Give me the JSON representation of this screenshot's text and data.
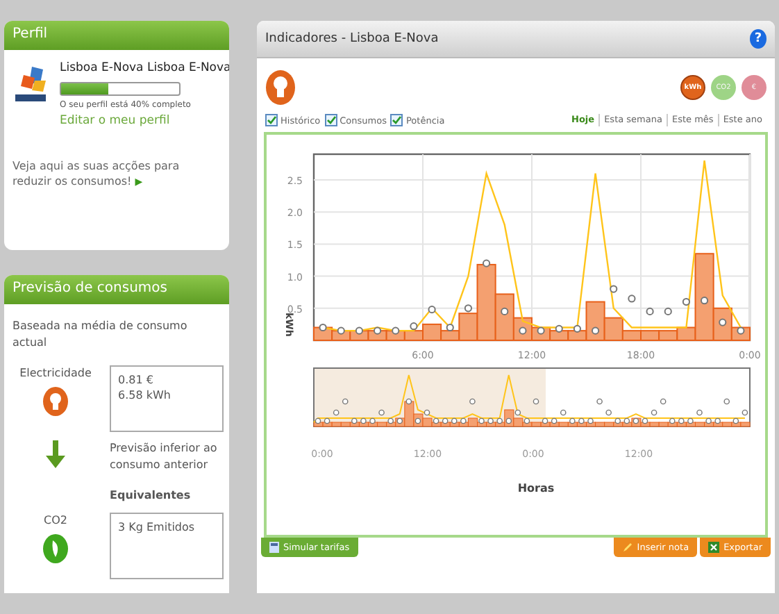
{
  "profile_card": {
    "title": "Perfil",
    "name": "Lisboa E-Nova Lisboa E-Nova",
    "progress": {
      "level": 0.4
    },
    "progress_caption": "O seu perfil está 40% completo",
    "edit_link": "Editar o meu perfil",
    "tip": "Veja aqui as suas acções para reduzir os consumos!",
    "tip_arrow": "▶"
  },
  "forecast_card": {
    "title": "Previsão de consumos",
    "intro": "Baseada na média de consumo actual",
    "electricity": {
      "label": "Electricidade",
      "lines": [
        "0.81 €",
        "6.58 kWh"
      ]
    },
    "trend": "Previsão inferior ao consumo anterior",
    "equivalents_title": "Equivalentes",
    "co2": {
      "label": "CO2",
      "lines": [
        "3 Kg Emitidos"
      ]
    }
  },
  "panel": {
    "title": "Indicadores - Lisboa E-Nova",
    "help": "?",
    "units": [
      {
        "label": "kWh",
        "selected": true,
        "color": "#e0641c"
      },
      {
        "label": "CO2",
        "selected": false,
        "color": "#9ed486"
      },
      {
        "label": "€",
        "selected": false,
        "color": "#e08c98"
      }
    ],
    "toggles": [
      {
        "label": "Histórico",
        "checked": true
      },
      {
        "label": "Consumos",
        "checked": true
      },
      {
        "label": "Potência",
        "checked": true
      }
    ],
    "periods": [
      {
        "label": "Hoje",
        "selected": true
      },
      {
        "label": "Esta semana",
        "selected": false
      },
      {
        "label": "Este mês",
        "selected": false
      },
      {
        "label": "Este ano",
        "selected": false
      }
    ],
    "chart_data": {
      "type": "bar",
      "ylabel": "kWh",
      "x": [
        0.5,
        1.5,
        2.5,
        3.5,
        4.5,
        5.5,
        6.5,
        7.5,
        8.5,
        9.5,
        10.5,
        11.5,
        12.5,
        13.5,
        14.5,
        15.5,
        16.5,
        17.5,
        18.5,
        19.5,
        20.5,
        21.5,
        22.5,
        23.5
      ],
      "series": [
        {
          "color": "#f4a070",
          "values": [
            0.2,
            0.15,
            0.15,
            0.15,
            0.15,
            0.15,
            0.25,
            0.15,
            0.42,
            1.18,
            0.72,
            0.35,
            0.2,
            0.15,
            0.15,
            0.6,
            0.35,
            0.15,
            0.15,
            0.15,
            0.2,
            1.35,
            0.5,
            0.2
          ]
        },
        {
          "type": "scatter",
          "color": "#777777",
          "values": [
            0.2,
            0.15,
            0.15,
            0.15,
            0.15,
            0.22,
            0.48,
            0.2,
            0.5,
            1.2,
            0.45,
            0.15,
            0.15,
            0.18,
            0.18,
            0.15,
            0.8,
            0.65,
            0.45,
            0.45,
            0.6,
            0.62,
            0.28,
            0.15
          ]
        },
        {
          "type": "line",
          "color": "#ffc41a",
          "values": [
            0.2,
            0.15,
            0.15,
            0.2,
            0.15,
            0.15,
            0.5,
            0.2,
            1.0,
            2.6,
            1.8,
            0.3,
            0.2,
            0.2,
            0.2,
            2.6,
            0.5,
            0.2,
            0.2,
            0.2,
            0.2,
            2.8,
            0.7,
            0.2
          ]
        }
      ],
      "xlim": [
        0,
        24
      ],
      "ylim": [
        0,
        2.9
      ],
      "grid": true,
      "xticks": [
        {
          "value": 6,
          "label": "6:00"
        },
        {
          "value": 12,
          "label": "12:00"
        },
        {
          "value": 18,
          "label": "18:00"
        },
        {
          "value": 24,
          "label": "0:00"
        }
      ],
      "yticks": [
        {
          "value": 0.5,
          "label": "0.5"
        },
        {
          "value": 1,
          "label": "1.0"
        },
        {
          "value": 1.5,
          "label": "1.5"
        },
        {
          "value": 2,
          "label": "2.0"
        },
        {
          "value": 2.5,
          "label": "2.5"
        }
      ]
    },
    "overview": {
      "tick_labels": [
        "0:00",
        "12:00",
        "0:00",
        "12:00"
      ],
      "xlabel": "Horas"
    },
    "buttons": [
      {
        "label": "Simular tarifas",
        "kind": "calculator"
      },
      {
        "label": "Inserir nota",
        "kind": "note"
      },
      {
        "label": "Exportar",
        "kind": "export"
      }
    ]
  }
}
